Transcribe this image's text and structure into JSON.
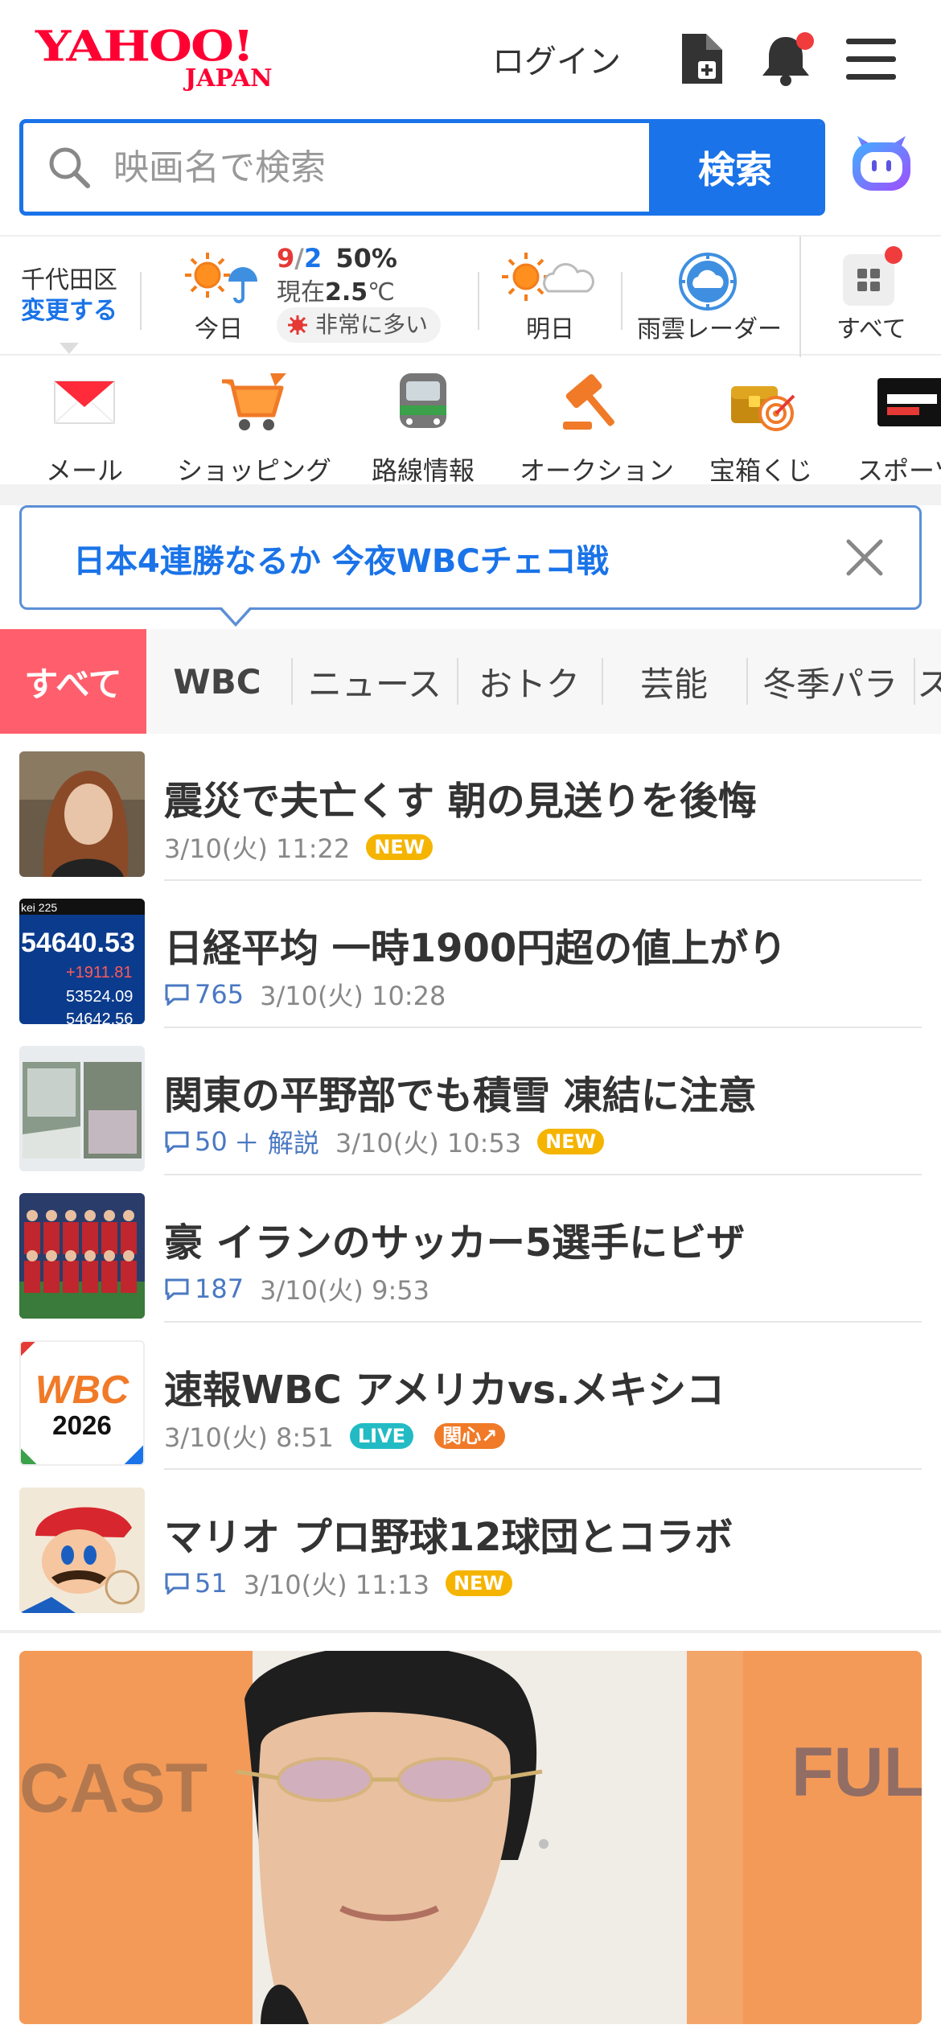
{
  "header": {
    "logo_main": "YAHOO!",
    "logo_sub": "JAPAN",
    "login_label": "ログイン"
  },
  "search": {
    "placeholder": "映画名で検索",
    "button_label": "検索"
  },
  "weather": {
    "location": "千代田区",
    "change_label": "変更する",
    "today_label": "今日",
    "temp_high": "9",
    "temp_sep": "/",
    "temp_low": "2",
    "precip": "50%",
    "now_prefix": "現在",
    "now_value": "2.5",
    "now_unit": "℃",
    "pollen_label": "非常に多い",
    "tomorrow_label": "明日",
    "radar_label": "雨雲レーダー",
    "all_label": "すべて"
  },
  "services": [
    {
      "label": "メール",
      "icon": "mail-icon"
    },
    {
      "label": "ショッピング",
      "icon": "shopping-cart-icon"
    },
    {
      "label": "路線情報",
      "icon": "train-icon"
    },
    {
      "label": "オークション",
      "icon": "auction-gavel-icon"
    },
    {
      "label": "宝箱くじ",
      "icon": "treasure-box-icon"
    },
    {
      "label": "スポーツ",
      "icon": "sports-icon"
    }
  ],
  "topic_banner": {
    "text": "日本4連勝なるか 今夜WBCチェコ戦"
  },
  "tabs": [
    "すべて",
    "WBC",
    "ニュース",
    "おトク",
    "芸能",
    "冬季パラ",
    "ス"
  ],
  "news": [
    {
      "title": "震災で夫亡くす 朝の見送りを後悔",
      "comments": "",
      "extra": "",
      "time": "3/10(火) 11:22",
      "badge": "NEW",
      "badge_type": "new"
    },
    {
      "title": "日経平均 一時1900円超の値上がり",
      "comments": "765",
      "extra": "",
      "time": "3/10(火) 10:28",
      "badge": "",
      "badge_type": ""
    },
    {
      "title": "関東の平野部でも積雪 凍結に注意",
      "comments": "50",
      "extra": "＋ 解説",
      "time": "3/10(火) 10:53",
      "badge": "NEW",
      "badge_type": "new"
    },
    {
      "title": "豪 イランのサッカー5選手にビザ",
      "comments": "187",
      "extra": "",
      "time": "3/10(火) 9:53",
      "badge": "",
      "badge_type": ""
    },
    {
      "title": "速報WBC アメリカvs.メキシコ",
      "comments": "",
      "extra": "",
      "time": "3/10(火) 8:51",
      "badge": "LIVE",
      "badge_type": "live",
      "badge2": "関心↗"
    },
    {
      "title": "マリオ プロ野球12球団とコラボ",
      "comments": "51",
      "extra": "",
      "time": "3/10(火) 11:13",
      "badge": "NEW",
      "badge_type": "new"
    }
  ],
  "thumb_texts": {
    "nikkei_top": "kei 225",
    "nikkei_main": "54640.53",
    "nikkei_change": "+1911.81",
    "nikkei_prev": "53524.09",
    "nikkei_prev2": "54642.56",
    "wbc_logo": "WBC",
    "wbc_year": "2026"
  },
  "feature_image": {
    "left_text": "CAST",
    "right_text": "FUL"
  },
  "colors": {
    "brand_red": "#ff0033",
    "accent_blue": "#1a73e8",
    "tab_active": "#ff5f6d",
    "badge_new": "#f5b400",
    "badge_live": "#22bbc4",
    "badge_hot": "#f07a28"
  }
}
